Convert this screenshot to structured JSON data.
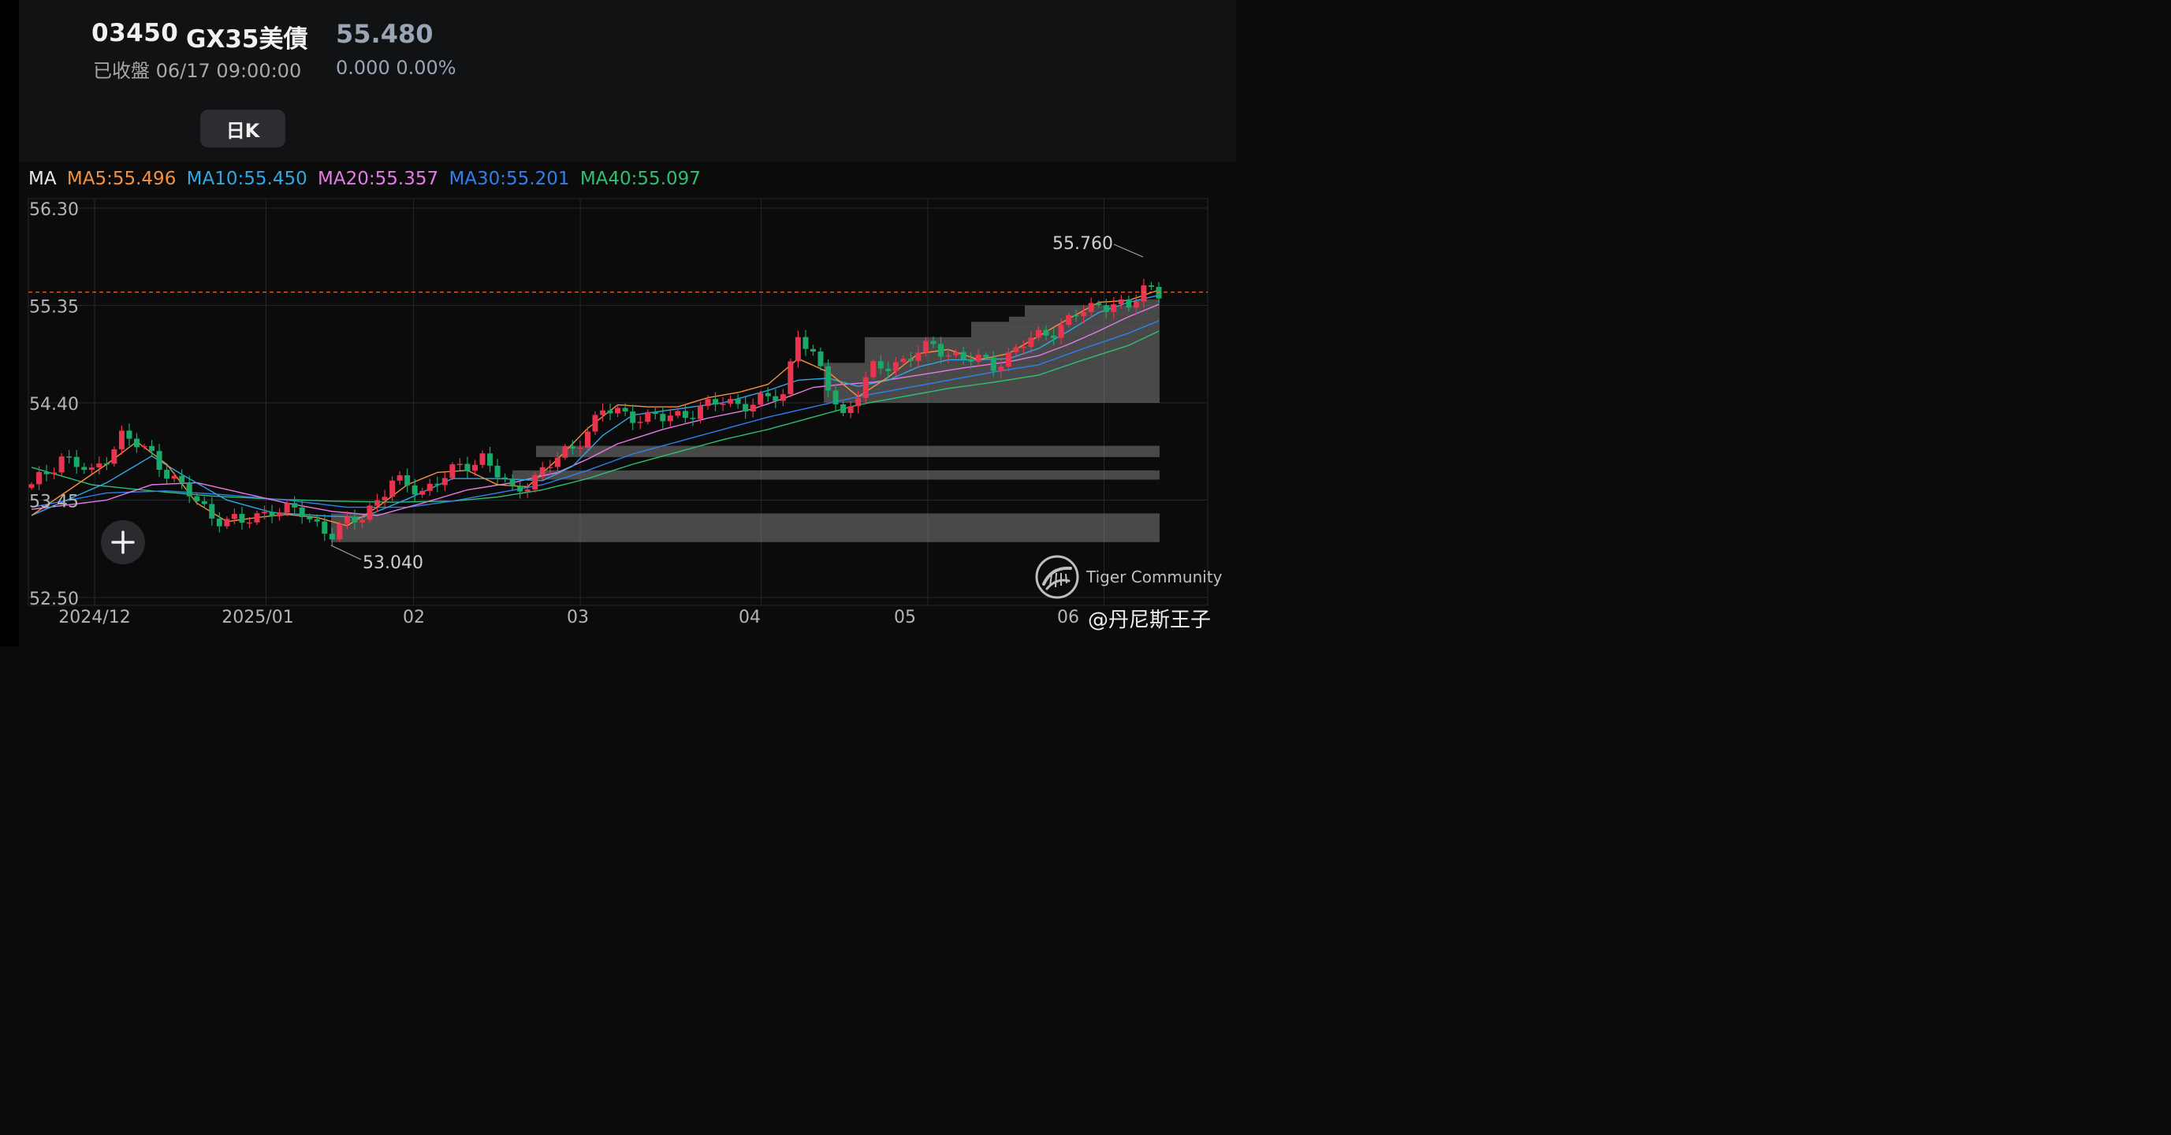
{
  "header": {
    "code": "03450",
    "name": "GX35美債",
    "price": "55.480",
    "status": "已收盤 06/17 09:00:00",
    "change": "0.000 0.00%",
    "period_label": "日K"
  },
  "indicator": {
    "label": "MA",
    "items": [
      {
        "text": "MA5:55.496",
        "color": "#f5913e"
      },
      {
        "text": "MA10:55.450",
        "color": "#2ea8e6"
      },
      {
        "text": "MA20:55.357",
        "color": "#e67ae6"
      },
      {
        "text": "MA30:55.201",
        "color": "#2f80ed"
      },
      {
        "text": "MA40:55.097",
        "color": "#2fbf71"
      }
    ]
  },
  "colors": {
    "up": "#e8344e",
    "down": "#1aa968",
    "current_line": "#e26a2c",
    "grid": "#25272b",
    "text": "#b5b5b5"
  },
  "chart_data": {
    "type": "candlestick",
    "ylim": [
      52.5,
      56.3
    ],
    "y_ticks": [
      "56.30",
      "55.35",
      "54.40",
      "53.45",
      "52.50"
    ],
    "x_ticks": [
      "2024/12",
      "2025/01",
      "02",
      "03",
      "04",
      "05",
      "06"
    ],
    "current_price": 55.48,
    "annotations": [
      {
        "text": "55.760",
        "refers_to": "high"
      },
      {
        "text": "53.040",
        "refers_to": "low"
      }
    ],
    "volume_profile_levels": [
      {
        "from": 53.04,
        "to": 53.32
      },
      {
        "from": 53.65,
        "to": 53.74
      },
      {
        "from": 53.87,
        "to": 53.98
      },
      {
        "from": 54.4,
        "to": 54.79
      },
      {
        "from": 54.79,
        "to": 55.04
      },
      {
        "from": 55.04,
        "to": 55.19
      },
      {
        "from": 55.19,
        "to": 55.24
      },
      {
        "from": 55.24,
        "to": 55.35
      },
      {
        "from": 55.35,
        "to": 55.41
      }
    ],
    "anchors": {
      "close": [
        [
          0,
          53.57
        ],
        [
          4,
          53.88
        ],
        [
          8,
          53.7
        ],
        [
          12,
          54.08
        ],
        [
          16,
          53.89
        ],
        [
          20,
          53.57
        ],
        [
          24,
          53.3
        ],
        [
          28,
          53.22
        ],
        [
          32,
          53.37
        ],
        [
          36,
          53.32
        ],
        [
          40,
          53.12
        ],
        [
          44,
          53.3
        ],
        [
          48,
          53.62
        ],
        [
          52,
          53.55
        ],
        [
          56,
          53.72
        ],
        [
          60,
          53.88
        ],
        [
          64,
          53.52
        ],
        [
          68,
          53.74
        ],
        [
          72,
          53.96
        ],
        [
          76,
          54.32
        ],
        [
          80,
          54.28
        ],
        [
          84,
          54.24
        ],
        [
          88,
          54.32
        ],
        [
          92,
          54.41
        ],
        [
          96,
          54.39
        ],
        [
          100,
          54.48
        ],
        [
          102,
          55.1
        ],
        [
          104,
          54.83
        ],
        [
          108,
          54.28
        ],
        [
          112,
          54.72
        ],
        [
          116,
          54.82
        ],
        [
          120,
          54.95
        ],
        [
          124,
          54.84
        ],
        [
          128,
          54.77
        ],
        [
          132,
          54.97
        ],
        [
          136,
          55.12
        ],
        [
          140,
          55.29
        ],
        [
          144,
          55.4
        ],
        [
          146,
          55.3
        ],
        [
          148,
          55.52
        ],
        [
          150,
          55.48
        ]
      ],
      "ma5": [
        [
          0,
          53.3
        ],
        [
          10,
          53.8
        ],
        [
          14,
          54.02
        ],
        [
          18,
          53.8
        ],
        [
          22,
          53.42
        ],
        [
          26,
          53.24
        ],
        [
          30,
          53.28
        ],
        [
          34,
          53.31
        ],
        [
          38,
          53.28
        ],
        [
          42,
          53.2
        ],
        [
          46,
          53.38
        ],
        [
          50,
          53.6
        ],
        [
          54,
          53.72
        ],
        [
          58,
          53.74
        ],
        [
          62,
          53.6
        ],
        [
          66,
          53.58
        ],
        [
          70,
          53.85
        ],
        [
          74,
          54.15
        ],
        [
          78,
          54.38
        ],
        [
          82,
          54.36
        ],
        [
          86,
          54.36
        ],
        [
          90,
          54.45
        ],
        [
          94,
          54.5
        ],
        [
          98,
          54.58
        ],
        [
          102,
          54.83
        ],
        [
          106,
          54.7
        ],
        [
          110,
          54.46
        ],
        [
          114,
          54.65
        ],
        [
          118,
          54.88
        ],
        [
          122,
          54.92
        ],
        [
          126,
          54.82
        ],
        [
          130,
          54.88
        ],
        [
          134,
          55.05
        ],
        [
          138,
          55.22
        ],
        [
          142,
          55.38
        ],
        [
          146,
          55.4
        ],
        [
          150,
          55.5
        ]
      ],
      "ma10": [
        [
          0,
          53.3
        ],
        [
          10,
          53.62
        ],
        [
          16,
          53.88
        ],
        [
          20,
          53.7
        ],
        [
          26,
          53.45
        ],
        [
          32,
          53.33
        ],
        [
          38,
          53.3
        ],
        [
          44,
          53.28
        ],
        [
          50,
          53.46
        ],
        [
          56,
          53.66
        ],
        [
          62,
          53.66
        ],
        [
          68,
          53.64
        ],
        [
          72,
          53.78
        ],
        [
          76,
          54.08
        ],
        [
          80,
          54.28
        ],
        [
          86,
          54.34
        ],
        [
          92,
          54.4
        ],
        [
          98,
          54.52
        ],
        [
          102,
          54.62
        ],
        [
          106,
          54.64
        ],
        [
          110,
          54.56
        ],
        [
          114,
          54.62
        ],
        [
          118,
          54.75
        ],
        [
          122,
          54.82
        ],
        [
          126,
          54.82
        ],
        [
          130,
          54.83
        ],
        [
          134,
          54.93
        ],
        [
          138,
          55.1
        ],
        [
          142,
          55.28
        ],
        [
          146,
          55.38
        ],
        [
          150,
          55.45
        ]
      ],
      "ma20": [
        [
          0,
          53.36
        ],
        [
          10,
          53.45
        ],
        [
          16,
          53.6
        ],
        [
          22,
          53.62
        ],
        [
          28,
          53.52
        ],
        [
          34,
          53.42
        ],
        [
          40,
          53.34
        ],
        [
          46,
          53.3
        ],
        [
          52,
          53.42
        ],
        [
          58,
          53.55
        ],
        [
          64,
          53.62
        ],
        [
          70,
          53.72
        ],
        [
          74,
          53.85
        ],
        [
          78,
          54.0
        ],
        [
          84,
          54.14
        ],
        [
          90,
          54.25
        ],
        [
          96,
          54.34
        ],
        [
          100,
          54.44
        ],
        [
          104,
          54.55
        ],
        [
          108,
          54.58
        ],
        [
          112,
          54.6
        ],
        [
          118,
          54.67
        ],
        [
          124,
          54.74
        ],
        [
          130,
          54.8
        ],
        [
          134,
          54.86
        ],
        [
          138,
          54.97
        ],
        [
          142,
          55.1
        ],
        [
          146,
          55.24
        ],
        [
          150,
          55.36
        ]
      ],
      "ma30": [
        [
          0,
          53.38
        ],
        [
          10,
          53.52
        ],
        [
          18,
          53.54
        ],
        [
          26,
          53.5
        ],
        [
          34,
          53.45
        ],
        [
          42,
          53.38
        ],
        [
          50,
          53.38
        ],
        [
          56,
          53.44
        ],
        [
          62,
          53.52
        ],
        [
          68,
          53.6
        ],
        [
          74,
          53.74
        ],
        [
          80,
          53.9
        ],
        [
          86,
          54.02
        ],
        [
          92,
          54.14
        ],
        [
          98,
          54.26
        ],
        [
          104,
          54.36
        ],
        [
          110,
          54.46
        ],
        [
          116,
          54.54
        ],
        [
          122,
          54.62
        ],
        [
          128,
          54.7
        ],
        [
          134,
          54.77
        ],
        [
          140,
          54.93
        ],
        [
          146,
          55.08
        ],
        [
          150,
          55.2
        ]
      ],
      "ma40": [
        [
          0,
          53.77
        ],
        [
          8,
          53.6
        ],
        [
          16,
          53.54
        ],
        [
          24,
          53.49
        ],
        [
          32,
          53.46
        ],
        [
          40,
          53.44
        ],
        [
          48,
          53.43
        ],
        [
          56,
          53.44
        ],
        [
          62,
          53.48
        ],
        [
          68,
          53.55
        ],
        [
          74,
          53.66
        ],
        [
          80,
          53.8
        ],
        [
          86,
          53.92
        ],
        [
          92,
          54.04
        ],
        [
          98,
          54.14
        ],
        [
          104,
          54.26
        ],
        [
          110,
          54.38
        ],
        [
          116,
          54.46
        ],
        [
          122,
          54.54
        ],
        [
          128,
          54.6
        ],
        [
          134,
          54.67
        ],
        [
          140,
          54.82
        ],
        [
          146,
          54.96
        ],
        [
          150,
          55.1
        ]
      ]
    }
  },
  "fab": {
    "icon": "plus-icon"
  },
  "watermark": {
    "text": "Tiger Community",
    "icon": "tiger-logo-icon"
  },
  "credit": "@丹尼斯王子"
}
